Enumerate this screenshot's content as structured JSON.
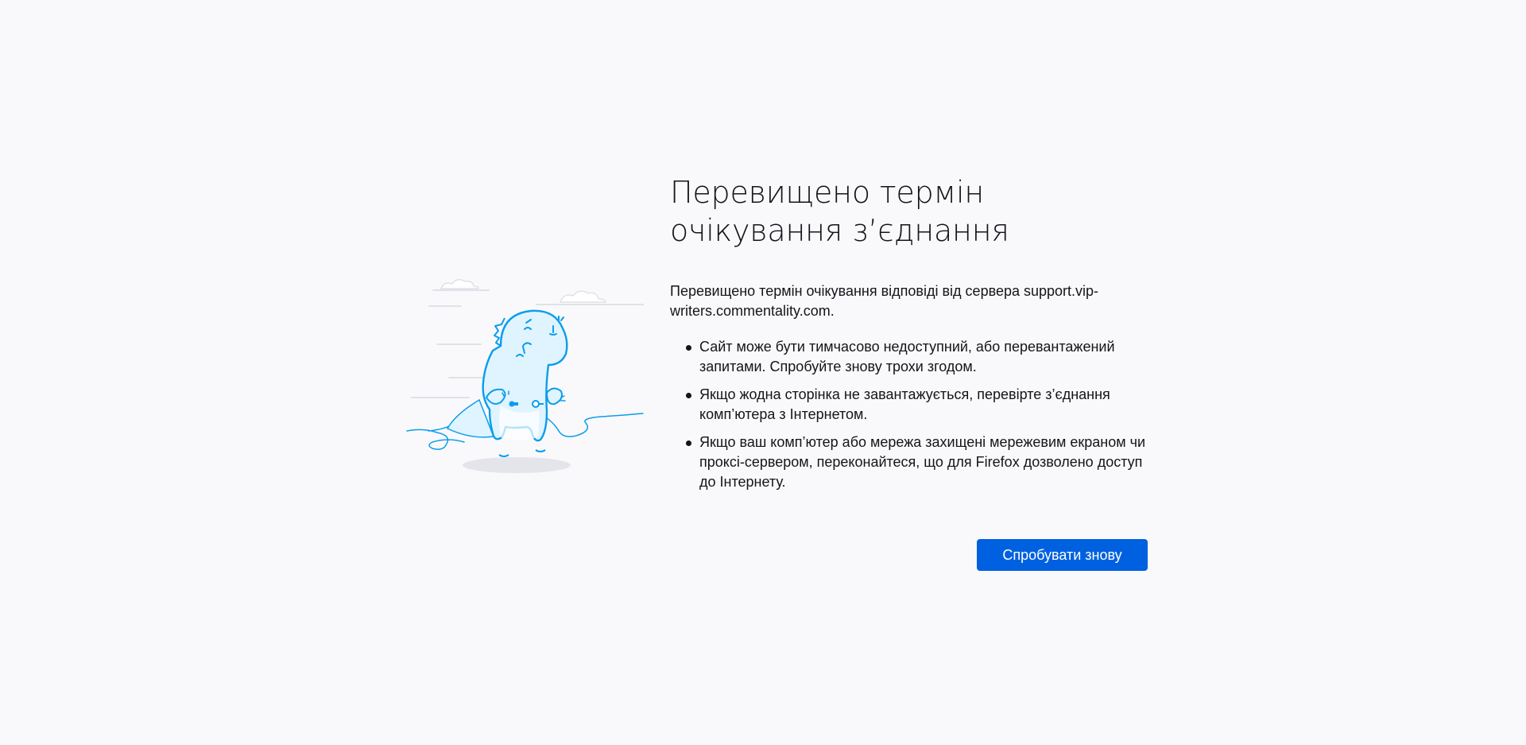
{
  "error": {
    "title": "Перевищено термін очікування з’єднання",
    "description": "Перевищено термін очікування відповіді від сервера support.vip-writers.commentality.com.",
    "tips": [
      "Сайт може бути тимчасово недоступний, або перевантажений запитами. Спробуйте знову трохи згодом.",
      "Якщо жодна сторінка не завантажується, перевірте з’єднання комп’ютера з Інтернетом.",
      "Якщо ваш комп’ютер або мережа захищені мережевим екраном чи проксі-сервером, переконайтеся, що для Firefox дозволено доступ до Інтернету."
    ],
    "retry_label": "Спробувати знову"
  },
  "illustration": {
    "icon": "unplugged-dinosaur-icon"
  },
  "colors": {
    "background": "#f9f9fb",
    "accent": "#0061e0",
    "illustration_stroke": "#0a9ded",
    "illustration_fill": "#e0f4ff"
  }
}
